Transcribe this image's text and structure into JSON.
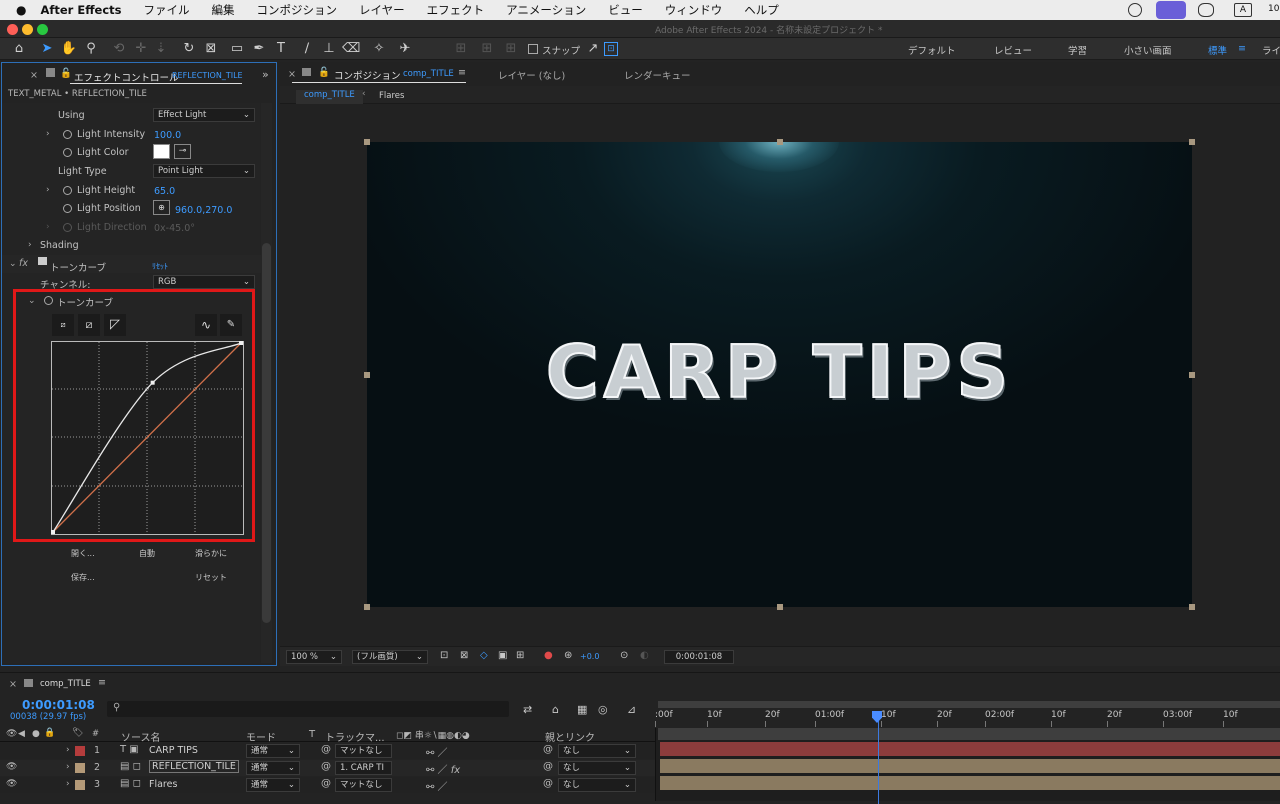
{
  "menubar": {
    "app_name": "After Effects",
    "items": [
      "ファイル",
      "編集",
      "コンポジション",
      "レイヤー",
      "エフェクト",
      "アニメーション",
      "ビュー",
      "ウィンドウ",
      "ヘルプ"
    ],
    "time": "10"
  },
  "window": {
    "title": "Adobe After Effects 2024 - 名称未設定プロジェクト *"
  },
  "toolbar": {
    "snap_label": "スナップ",
    "workspaces": [
      "デフォルト",
      "レビュー",
      "学習",
      "小さい画面",
      "標準",
      "ライ"
    ],
    "active_workspace": "標準"
  },
  "effect_panel": {
    "tab_label": "エフェクトコントロール",
    "tab_layer": "REFLECTION_TILE",
    "breadcrumb": "TEXT_METAL • REFLECTION_TILE",
    "using_label": "Using",
    "using_value": "Effect Light",
    "light_intensity_label": "Light Intensity",
    "light_intensity_value": "100.0",
    "light_color_label": "Light Color",
    "light_type_label": "Light Type",
    "light_type_value": "Point Light",
    "light_height_label": "Light Height",
    "light_height_value": "65.0",
    "light_position_label": "Light Position",
    "light_position_value": "960.0,270.0",
    "light_direction_label": "Light Direction",
    "light_direction_value": "0x-45.0°",
    "shading_label": "Shading",
    "fx_label": "fx",
    "tone_curve_label": "トーンカーブ",
    "reset_label": "ﾘｾｯﾄ",
    "channel_label": "チャンネル:",
    "channel_value": "RGB",
    "tone_curve_sub_label": "トーンカーブ",
    "buttons": {
      "open": "開く...",
      "auto": "自動",
      "smooth": "滑らかに",
      "save": "保存...",
      "reset": "リセット"
    }
  },
  "comp_panel": {
    "tab_label": "コンポジション",
    "tab_comp": "comp_TITLE",
    "layer_tab": "レイヤー (なし)",
    "render_tab": "レンダーキュー",
    "breadcrumb_comp": "comp_TITLE",
    "breadcrumb_sub": "Flares",
    "title_text": "CARP TIPS",
    "zoom": "100 %",
    "quality": "(フル画質)",
    "exposure": "+0.0",
    "timecode": "0:00:01:08"
  },
  "timeline": {
    "tab_label": "comp_TITLE",
    "timecode": "0:00:01:08",
    "frames": "00038 (29.97 fps)",
    "search_placeholder": "",
    "headers": {
      "source": "ソース名",
      "mode": "モード",
      "t": "T",
      "track": "トラックマ...",
      "parent": "親とリンク"
    },
    "ruler": [
      ":00f",
      "10f",
      "20f",
      "01:00f",
      "10f",
      "20f",
      "02:00f",
      "10f",
      "20f",
      "03:00f",
      "10f"
    ],
    "layers": [
      {
        "num": "1",
        "type": "T",
        "name": "CARP TIPS",
        "mode": "通常",
        "track": "マットなし",
        "parent": "なし",
        "color": "#b43c3c"
      },
      {
        "num": "2",
        "type": "img",
        "name": "REFLECTION_TILE",
        "mode": "通常",
        "track": "1. CARP TI",
        "parent": "なし",
        "color": "#b49a78"
      },
      {
        "num": "3",
        "type": "img",
        "name": "Flares",
        "mode": "通常",
        "track": "マットなし",
        "parent": "なし",
        "color": "#b49a78"
      }
    ]
  },
  "curve": {
    "control_points": [
      [
        0,
        0
      ],
      [
        0.53,
        0.79
      ],
      [
        1,
        1
      ]
    ],
    "baseline": [
      [
        0,
        0
      ],
      [
        1,
        1
      ]
    ]
  },
  "colors": {
    "accent": "#3d9bff",
    "highlight_box": "#e01818",
    "layer1_bar": "#8c3c3c",
    "layer_bar": "#8a7a60"
  }
}
